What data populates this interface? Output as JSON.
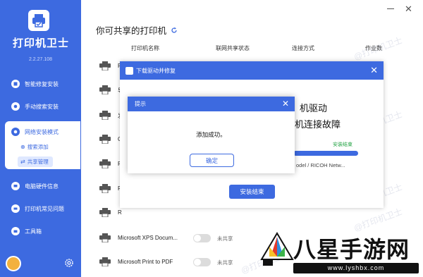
{
  "app": {
    "name": "打印机卫士",
    "version": "2.2.27.108"
  },
  "sidebar": {
    "items": [
      {
        "label": "智能修复安装",
        "icon": "wrench-icon"
      },
      {
        "label": "手动搜索安装",
        "icon": "hand-icon"
      },
      {
        "label": "网络安装模式",
        "icon": "network-icon"
      },
      {
        "label": "电脑硬件信息",
        "icon": "computer-icon"
      },
      {
        "label": "打印机常见问题",
        "icon": "printer-icon"
      },
      {
        "label": "工具箱",
        "icon": "toolbox-icon"
      }
    ],
    "sub_items": [
      {
        "label": "搜索添加",
        "icon": "search-icon"
      },
      {
        "label": "共享管理",
        "icon": "share-icon"
      }
    ]
  },
  "main": {
    "title": "你可共享的打印机",
    "columns": [
      "打印机名称",
      "联网共享状态",
      "连接方式",
      "作业数"
    ],
    "rows": [
      {
        "name": "R"
      },
      {
        "name": "导"
      },
      {
        "name": "发"
      },
      {
        "name": "O"
      },
      {
        "name": "R"
      },
      {
        "name": "R"
      },
      {
        "name": "R"
      },
      {
        "name": "Microsoft XPS Docum...",
        "status": "未共享"
      },
      {
        "name": "Microsoft Print to PDF",
        "status": "未共享"
      }
    ]
  },
  "driver_dialog": {
    "title": "下载驱动并修复",
    "text1": "机驱动",
    "text2": "机连接故障",
    "status": "安装结束",
    "model": "odel / RICOH Netw...",
    "button": "安装结束",
    "progress_percent": 100
  },
  "tip_dialog": {
    "title": "提示",
    "message": "添加成功。",
    "button": "确定"
  },
  "watermark": "@打印机卫士",
  "brand": {
    "name": "八星手游网",
    "url": "www.lyshbx.com"
  },
  "colors": {
    "primary": "#3d6ae0",
    "success": "#2aa64a"
  }
}
